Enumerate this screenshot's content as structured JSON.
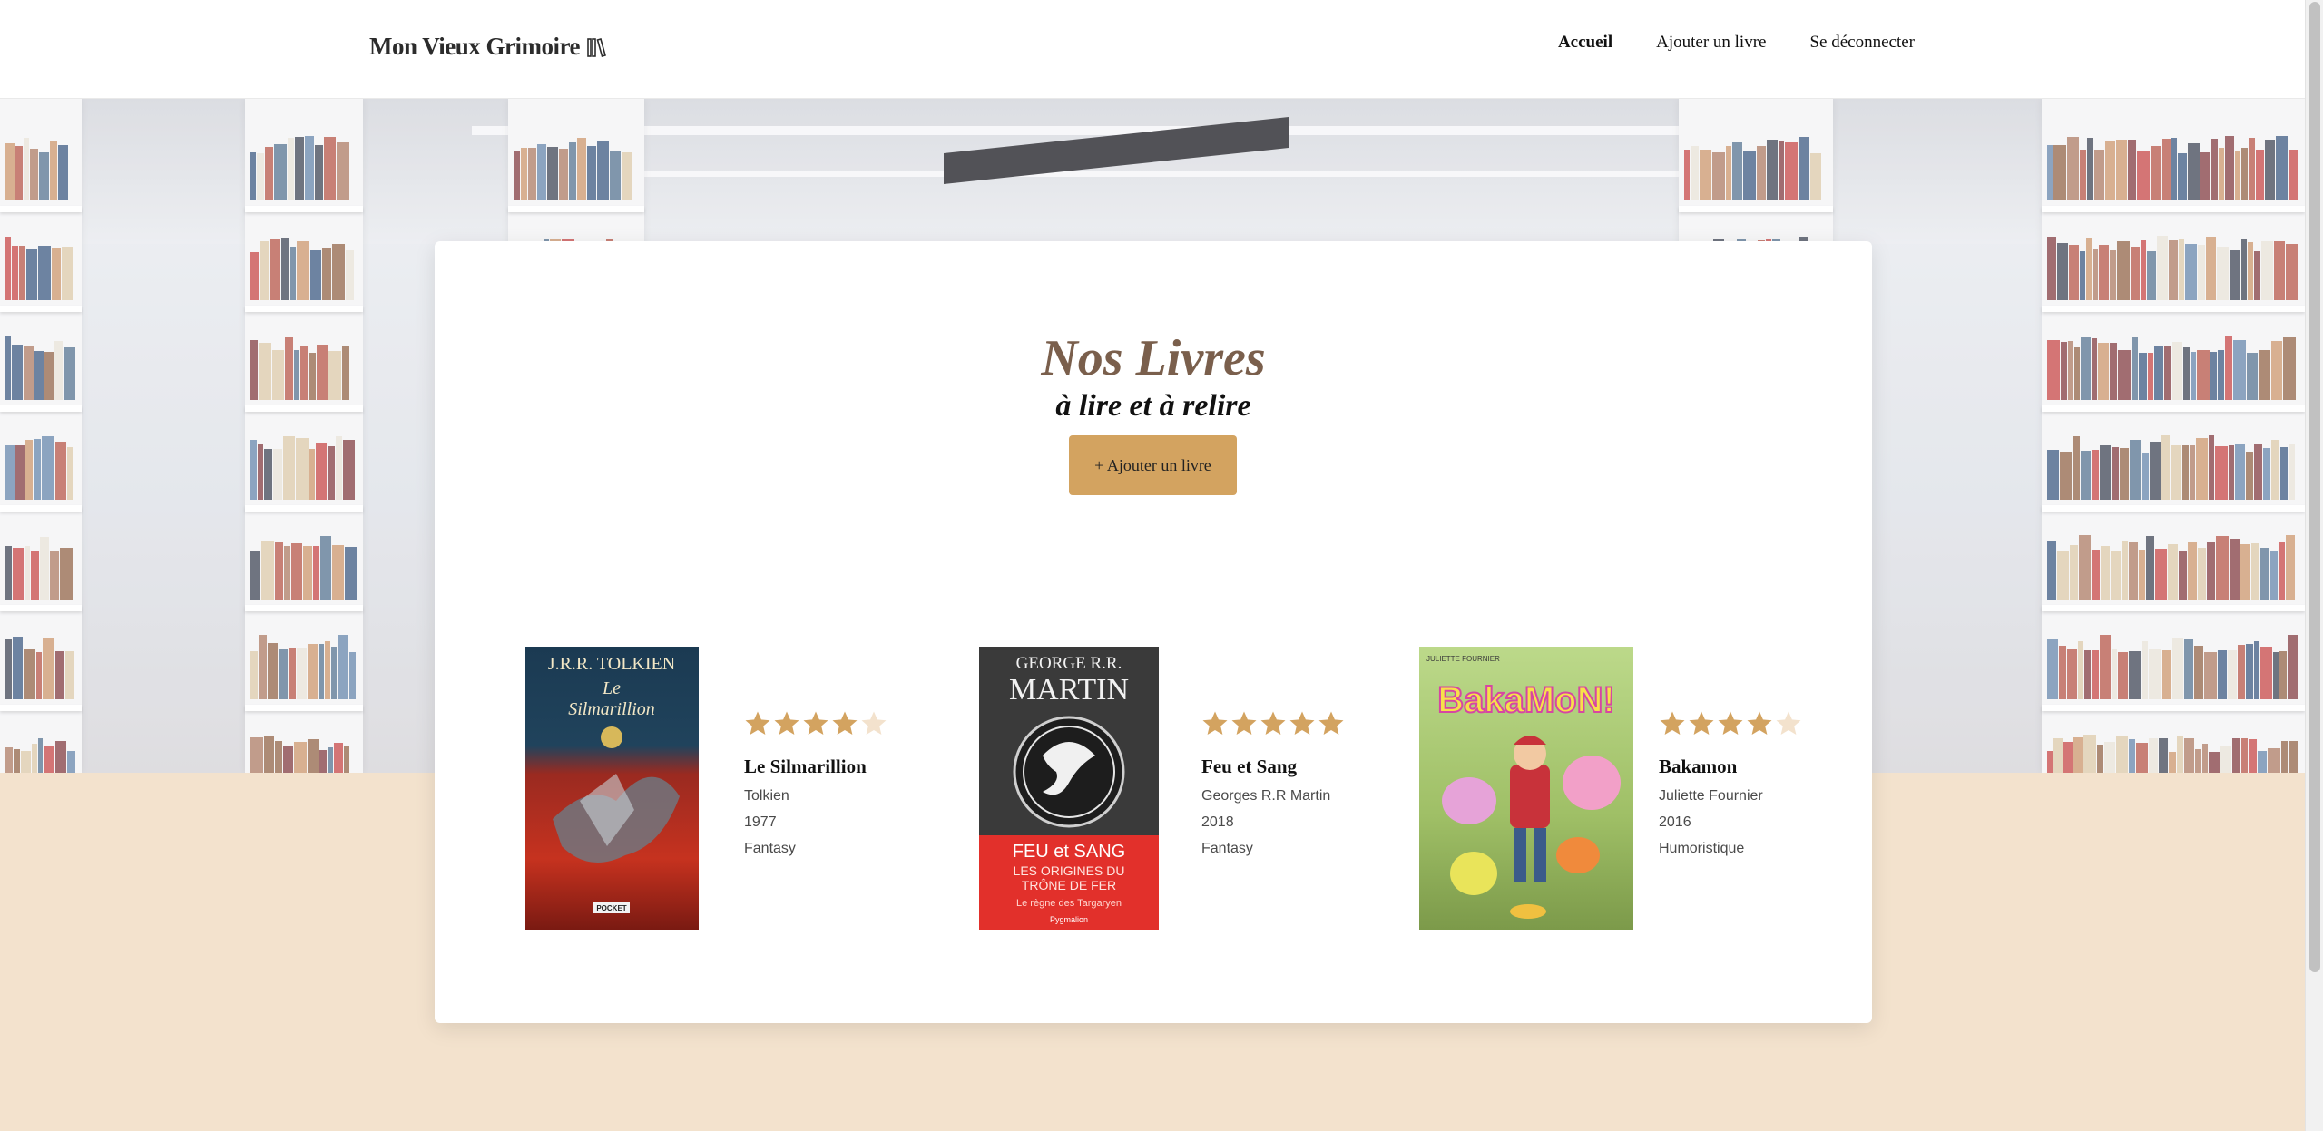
{
  "header": {
    "logo_text": "Mon Vieux Grimoire",
    "nav": [
      "Accueil",
      "Ajouter un livre",
      "Se déconnecter"
    ]
  },
  "main": {
    "title": "Nos Livres",
    "subtitle": "à lire et à relire",
    "add_button": "+ Ajouter un livre"
  },
  "books": [
    {
      "title": "Le Silmarillion",
      "author": "Tolkien",
      "year": "1977",
      "genre": "Fantasy",
      "rating": 4,
      "cover": {
        "top": "J.R.R. TOLKIEN",
        "line1": "Le",
        "line2": "Silmarillion",
        "badge": "POCKET"
      }
    },
    {
      "title": "Feu et Sang",
      "author": "Georges R.R Martin",
      "year": "2018",
      "genre": "Fantasy",
      "rating": 5,
      "cover": {
        "top": "GEORGE R.R.",
        "name": "MARTIN",
        "line1": "FEU et SANG",
        "line2": "LES ORIGINES DU",
        "line3": "TRÔNE DE FER",
        "line4": "Le règne des Targaryen",
        "badge": "Pygmalion"
      }
    },
    {
      "title": "Bakamon",
      "author": "Juliette Fournier",
      "year": "2016",
      "genre": "Humoristique",
      "rating": 4,
      "cover": {
        "top": "JULIETTE FOURNIER",
        "logo": "BakaMoN!"
      }
    }
  ],
  "colors": {
    "accent": "#d3a360",
    "star_filled": "#d3a360",
    "star_empty": "#f3e2cd",
    "title": "#7a5f4c",
    "page_bg": "#f3e2cd"
  }
}
